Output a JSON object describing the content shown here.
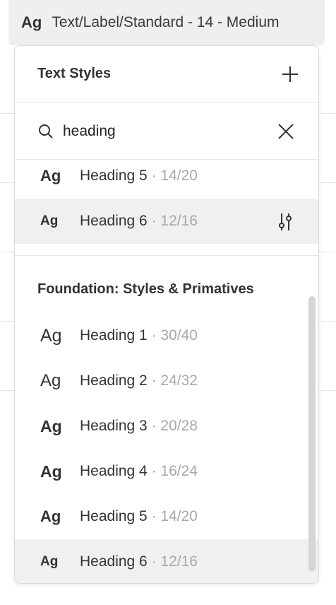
{
  "trigger": {
    "ag": "Ag",
    "label": "Text/Label/Standard - 14 - Medium"
  },
  "popover": {
    "title": "Text Styles",
    "add_icon": "plus-icon",
    "search": {
      "value": "heading",
      "icon": "search-icon",
      "clear_icon": "close-icon"
    },
    "local_styles": [
      {
        "ag": "Ag",
        "name": "Heading 5",
        "meta": " · 14/20"
      },
      {
        "ag": "Ag",
        "name": "Heading 6",
        "meta": " · 12/16",
        "selected": true,
        "action_icon": "adjust-sliders-icon"
      }
    ],
    "library": {
      "title": "Foundation: Styles & Primatives",
      "styles": [
        {
          "ag": "Ag",
          "name": "Heading 1",
          "meta": " · 30/40"
        },
        {
          "ag": "Ag",
          "name": "Heading 2",
          "meta": " · 24/32"
        },
        {
          "ag": "Ag",
          "name": "Heading 3",
          "meta": " · 20/28"
        },
        {
          "ag": "Ag",
          "name": "Heading 4",
          "meta": " · 16/24"
        },
        {
          "ag": "Ag",
          "name": "Heading 5",
          "meta": " · 14/20"
        },
        {
          "ag": "Ag",
          "name": "Heading 6",
          "meta": " · 12/16",
          "selected": true
        }
      ]
    }
  }
}
